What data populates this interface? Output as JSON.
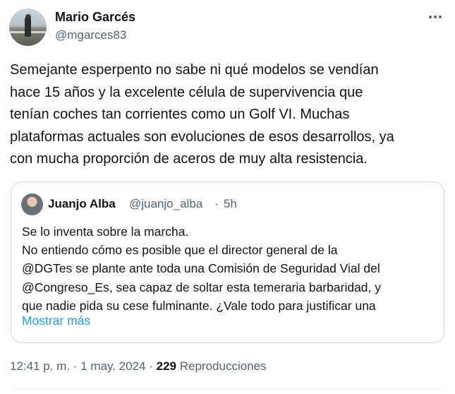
{
  "author": {
    "name": "Mario Garcés",
    "handle": "@mgarces83"
  },
  "tweet": {
    "lines": [
      "Semejante esperpento no sabe ni qué modelos se vendían",
      "hace 15 años y la excelente célula de supervivencia que",
      "tenían coches tan corrientes como un Golf VI. Muchas",
      "plataformas actuales son evoluciones de esos desarrollos, ya",
      "con mucha proporción de aceros de muy alta resistencia."
    ]
  },
  "quote": {
    "name": "Juanjo Alba",
    "handle": "@juanjo_alba",
    "separator": "·",
    "time": "5h",
    "lines": [
      "Se lo inventa sobre la marcha.",
      "No entiendo cómo es posible que el director general de la",
      "@DGTes se plante ante toda una Comisión de Seguridad Vial del",
      "@Congreso_Es, sea capaz de soltar esta temeraria barbaridad, y",
      "que nadie pida su cese fulminante. ¿Vale todo para justificar una"
    ],
    "show_more": "Mostrar más"
  },
  "meta": {
    "time": "12:41 p. m.",
    "sep1": "·",
    "date": "1 may. 2024",
    "sep2": "·",
    "views_count": "229",
    "views_label": "Reproducciones"
  }
}
